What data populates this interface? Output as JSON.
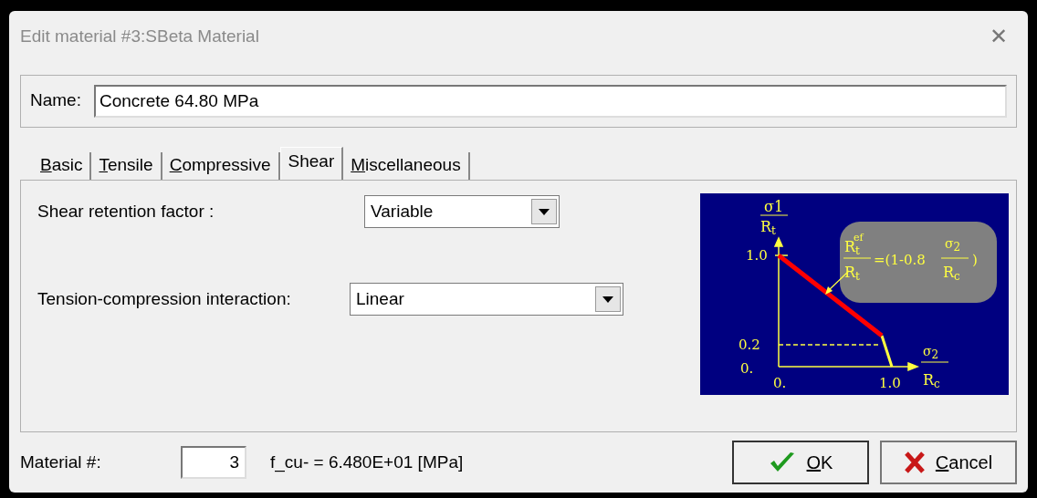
{
  "window": {
    "title": "Edit material #3:SBeta Material",
    "close": "✕"
  },
  "name_field": {
    "label": "Name:",
    "value": "Concrete 64.80 MPa"
  },
  "tabs": [
    {
      "label": "Basic",
      "selected": false,
      "mnemonic": true
    },
    {
      "label": "Tensile",
      "selected": false,
      "mnemonic": true
    },
    {
      "label": "Compressive",
      "selected": false,
      "mnemonic": true
    },
    {
      "label": "Shear",
      "selected": true,
      "mnemonic": false
    },
    {
      "label": "Miscellaneous",
      "selected": false,
      "mnemonic": true
    }
  ],
  "fields": [
    {
      "label": "Shear retention factor :",
      "value": "Variable",
      "wide": false
    },
    {
      "label": "Tension-compression interaction:",
      "value": "Linear",
      "wide": true
    }
  ],
  "diagram": {
    "y_axis": {
      "num": "σ1",
      "den": "R",
      "den_sub": "t"
    },
    "x_axis": {
      "num": "σ",
      "num_sub": "2",
      "den": "R",
      "den_sub": "c"
    },
    "y_ticks": [
      "1.0",
      "0.2",
      "0."
    ],
    "x_ticks": [
      "0.",
      "1.0"
    ],
    "formula": {
      "r": "R",
      "r_sup": "ef",
      "r_sub": "t",
      "den": "R",
      "den_sub": "t",
      "eq": "=(1-0.8",
      "s": "σ",
      "s_sub": "2",
      "rc": "R",
      "rc_sub": "c",
      "close": ")"
    }
  },
  "footer": {
    "material_label": "Material #:",
    "material_value": "3",
    "info": "f_cu- = 6.480E+01 [MPa]"
  },
  "buttons": [
    {
      "label": "OK",
      "kind": "ok",
      "mnemonic": true
    },
    {
      "label": "Cancel",
      "kind": "cancel",
      "mnemonic": true
    }
  ]
}
